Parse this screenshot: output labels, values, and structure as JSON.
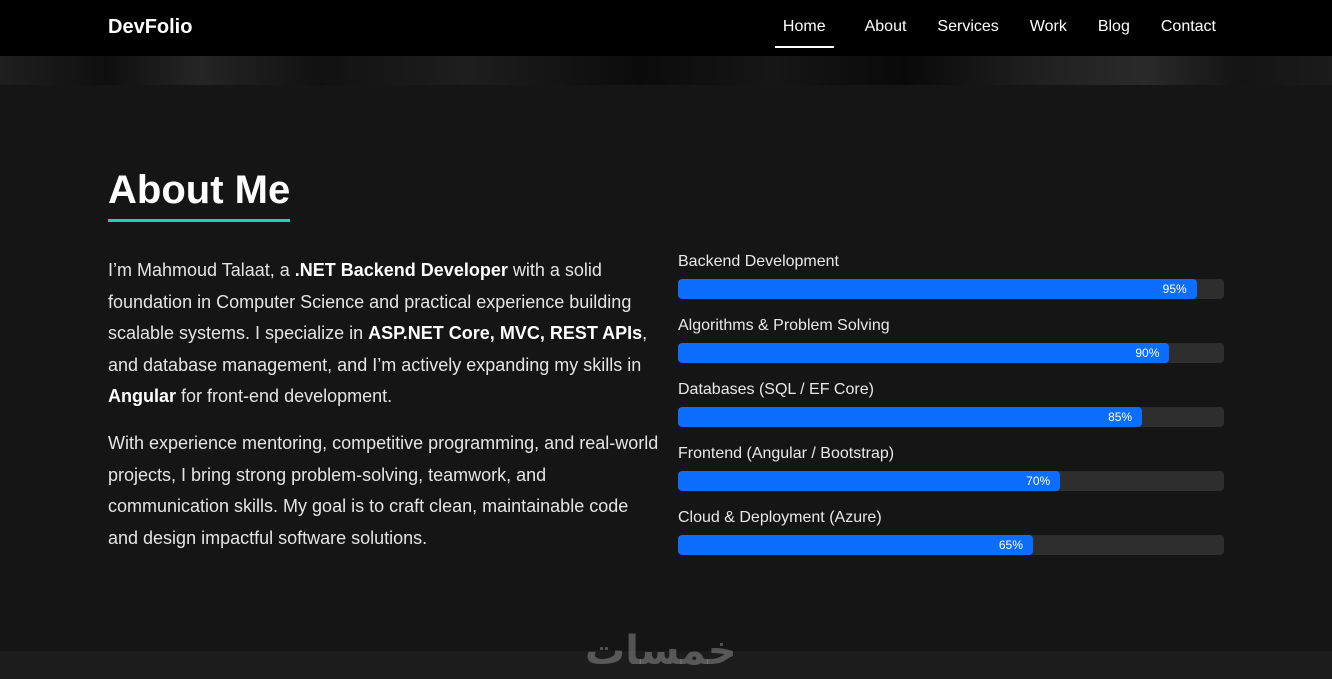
{
  "nav": {
    "brand": "DevFolio",
    "links": [
      "Home",
      "About",
      "Services",
      "Work",
      "Blog",
      "Contact"
    ]
  },
  "about": {
    "title": "About Me",
    "p1": {
      "t1": "I’m Mahmoud Talaat, a ",
      "b1": ".NET Backend Developer",
      "t2": " with a solid foundation in Computer Science and practical experience building scalable systems. I specialize in ",
      "b2": "ASP.NET Core, MVC, REST APIs",
      "t3": ", and database management, and I’m actively expanding my skills in ",
      "b3": "Angular",
      "t4": " for front-end development."
    },
    "p2": "With experience mentoring, competitive programming, and real-world projects, I bring strong problem-solving, teamwork, and communication skills. My goal is to craft clean, maintainable code and design impactful software solutions."
  },
  "skills": [
    {
      "name": "Backend Development",
      "percent": 95,
      "label": "95%"
    },
    {
      "name": "Algorithms & Problem Solving",
      "percent": 90,
      "label": "90%"
    },
    {
      "name": "Databases (SQL / EF Core)",
      "percent": 85,
      "label": "85%"
    },
    {
      "name": "Frontend (Angular / Bootstrap)",
      "percent": 70,
      "label": "70%"
    },
    {
      "name": "Cloud & Deployment (Azure)",
      "percent": 65,
      "label": "65%"
    }
  ],
  "colors": {
    "accent_underline": "#1fd1b4",
    "bar_fill": "#0d6efd",
    "bar_track": "#2e2e2e"
  },
  "watermark": "خمسات"
}
